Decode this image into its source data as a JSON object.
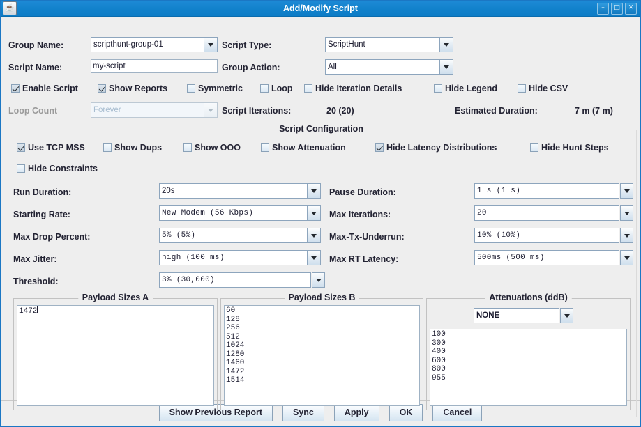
{
  "window": {
    "title": "Add/Modify Script",
    "app_icon": "java-coffee-cup-icon",
    "minimize_label": "–",
    "maximize_label": "□",
    "close_label": "✕"
  },
  "form": {
    "group_name_label": "Group Name:",
    "group_name_value": "scripthunt-group-01",
    "script_type_label": "Script Type:",
    "script_type_value": "ScriptHunt",
    "script_name_label": "Script Name:",
    "script_name_value": "my-script",
    "group_action_label": "Group Action:",
    "group_action_value": "All",
    "loop_count_label": "Loop Count",
    "loop_count_value": "Forever",
    "script_iterations_label": "Script Iterations:",
    "script_iterations_value": "20 (20)",
    "estimated_duration_label": "Estimated Duration:",
    "estimated_duration_value": "7 m (7 m)"
  },
  "top_checkboxes": [
    {
      "label": "Enable Script",
      "checked": true
    },
    {
      "label": "Show Reports",
      "checked": true
    },
    {
      "label": "Symmetric",
      "checked": false
    },
    {
      "label": "Loop",
      "checked": false
    },
    {
      "label": "Hide Iteration Details",
      "checked": false
    },
    {
      "label": "Hide Legend",
      "checked": false
    },
    {
      "label": "Hide CSV",
      "checked": false
    }
  ],
  "script_config": {
    "title": "Script Configuration",
    "checkboxes": [
      {
        "label": "Use TCP MSS",
        "checked": true
      },
      {
        "label": "Show Dups",
        "checked": false
      },
      {
        "label": "Show OOO",
        "checked": false
      },
      {
        "label": "Show Attenuation",
        "checked": false
      },
      {
        "label": "Hide Latency Distributions",
        "checked": true
      },
      {
        "label": "Hide Hunt Steps",
        "checked": false
      },
      {
        "label": "Hide Constraints",
        "checked": false
      }
    ],
    "fields_left": [
      {
        "label": "Run Duration:",
        "value": "20s",
        "mono": false
      },
      {
        "label": "Starting Rate:",
        "value": "New Modem (56 Kbps)",
        "mono": true
      },
      {
        "label": "Max Drop Percent:",
        "value": "5% (5%)",
        "mono": true
      },
      {
        "label": "Max Jitter:",
        "value": "high (100 ms)",
        "mono": true
      },
      {
        "label": "Threshold:",
        "value": " 3%   (30,000)",
        "mono": true
      }
    ],
    "fields_right": [
      {
        "label": "Pause Duration:",
        "value": "1 s   (1 s)",
        "mono": true
      },
      {
        "label": "Max Iterations:",
        "value": "20",
        "mono": true
      },
      {
        "label": "Max-Tx-Underrun:",
        "value": "10% (10%)",
        "mono": true
      },
      {
        "label": "Max RT Latency:",
        "value": "500ms (500 ms)",
        "mono": true
      }
    ]
  },
  "payload_a": {
    "title": "Payload Sizes A",
    "lines": [
      "1472"
    ]
  },
  "payload_b": {
    "title": "Payload Sizes B",
    "lines": [
      "60",
      "128",
      "256",
      "512",
      "1024",
      "1280",
      "1460",
      "1472",
      "1514"
    ]
  },
  "attenuations": {
    "title": "Attenuations (ddB)",
    "selected": "NONE",
    "lines": [
      "100",
      "300",
      "400",
      "600",
      "800",
      "955"
    ]
  },
  "buttons": [
    {
      "label": "Show Previous Report"
    },
    {
      "label": "Sync"
    },
    {
      "label": "Apply"
    },
    {
      "label": "OK"
    },
    {
      "label": "Cancel"
    }
  ]
}
